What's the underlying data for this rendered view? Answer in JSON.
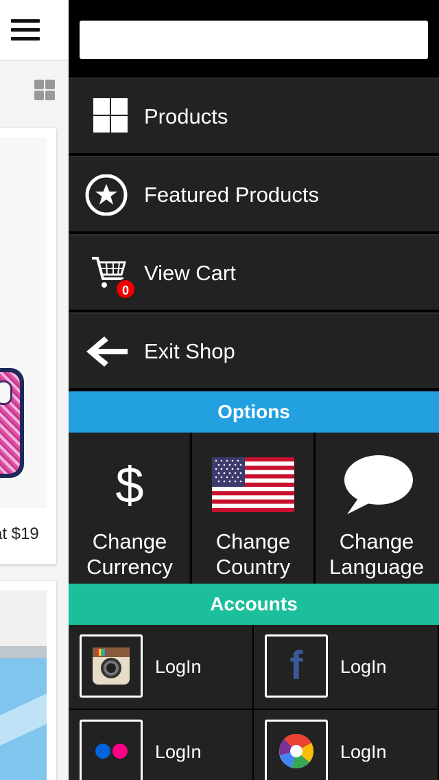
{
  "left_page": {
    "price_text": "at $19"
  },
  "search": {
    "value": "",
    "placeholder": ""
  },
  "menu": {
    "items": [
      {
        "label": "Products",
        "icon": "grid-icon"
      },
      {
        "label": "Featured Products",
        "icon": "star-circle-icon"
      },
      {
        "label": "View Cart",
        "icon": "cart-icon",
        "badge": "0"
      },
      {
        "label": "Exit Shop",
        "icon": "arrow-left-icon"
      }
    ]
  },
  "options": {
    "header": "Options",
    "color": "#22a0e0",
    "items": [
      {
        "label": "Change Currency",
        "icon": "dollar-icon",
        "glyph": "$"
      },
      {
        "label": "Change Country",
        "icon": "us-flag-icon"
      },
      {
        "label": "Change Language",
        "icon": "speech-bubble-icon"
      }
    ]
  },
  "accounts": {
    "header": "Accounts",
    "color": "#1cbf9b",
    "items": [
      {
        "label": "LogIn",
        "icon": "instagram-icon"
      },
      {
        "label": "LogIn",
        "icon": "facebook-icon",
        "glyph": "f"
      },
      {
        "label": "LogIn",
        "icon": "flickr-icon"
      },
      {
        "label": "LogIn",
        "icon": "picasa-icon"
      }
    ]
  }
}
